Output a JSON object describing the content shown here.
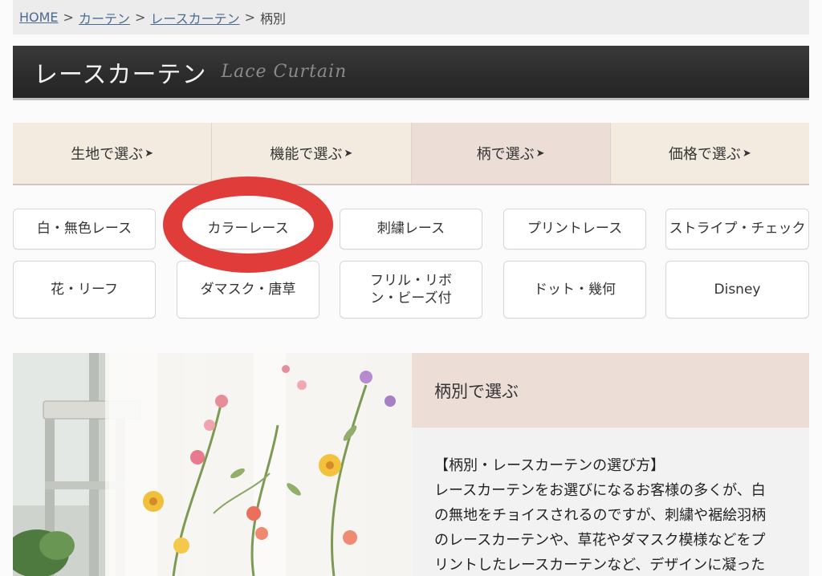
{
  "breadcrumb": {
    "home": "HOME",
    "curtain": "カーテン",
    "lace_curtain": "レースカーテン",
    "current": "柄別",
    "separator": ">"
  },
  "header": {
    "title": "レースカーテン",
    "subtitle": "Lace Curtain"
  },
  "tabs": [
    {
      "label": "生地で選ぶ",
      "arrow": "➤"
    },
    {
      "label": "機能で選ぶ",
      "arrow": "➤"
    },
    {
      "label": "柄で選ぶ",
      "arrow": "➤"
    },
    {
      "label": "価格で選ぶ",
      "arrow": "➤"
    }
  ],
  "pattern_buttons": [
    {
      "label": "白・無色レース"
    },
    {
      "label": "カラーレース"
    },
    {
      "label": "刺繍レース"
    },
    {
      "label": "プリントレース"
    },
    {
      "label": "ストライプ・チェック"
    },
    {
      "label": "花・リーフ"
    },
    {
      "label": "ダマスク・唐草"
    },
    {
      "label": "フリル・リボン・ビーズ付"
    },
    {
      "label": "ドット・幾何"
    },
    {
      "label": "Disney"
    }
  ],
  "annotation": {
    "color": "#e03c3a"
  },
  "info": {
    "heading": "柄別で選ぶ",
    "body_title": "【柄別・レースカーテンの選び方】",
    "body_lines": [
      "レースカーテンをお選びになるお客様の多くが、白",
      "の無地をチョイスされるのですが、刺繍や裾絵羽柄",
      "のレースカーテンや、草花やダマスク模様などをプ",
      "リントしたレースカーテンなど、デザインに凝った"
    ]
  },
  "colors": {
    "tab_bg": "#f3ebdf",
    "tab_active_bg": "#ecddd6",
    "header_bg": "#2b2b2b",
    "link": "#4a6a93"
  }
}
